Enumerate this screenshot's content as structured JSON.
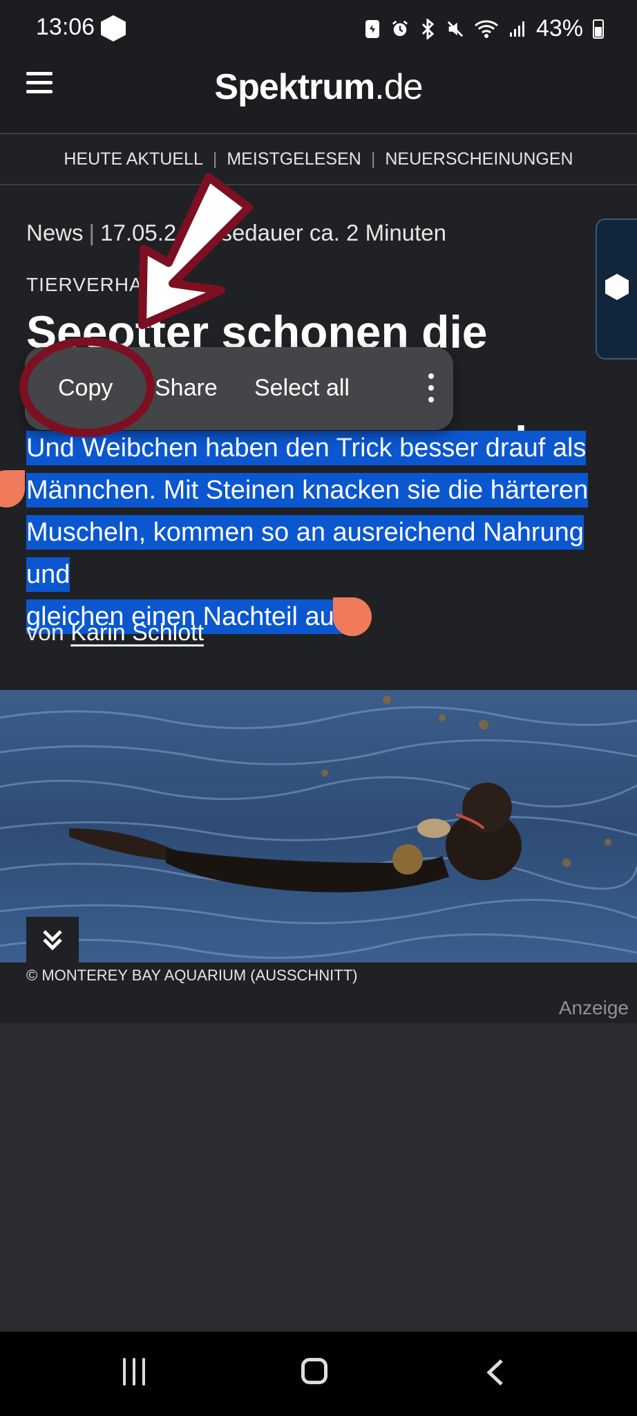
{
  "status_bar": {
    "time": "13:06",
    "battery_percent": "43%",
    "icons": [
      "app-shield-icon",
      "sim-icon",
      "alarm-icon",
      "bluetooth-icon",
      "mute-icon",
      "wifi-icon",
      "signal-icon",
      "battery-icon"
    ]
  },
  "header": {
    "logo_main": "Spektrum",
    "logo_tld": ".de",
    "menu_icon": "hamburger-menu-icon"
  },
  "top_nav": {
    "items": [
      "HEUTE AKTUELL",
      "MEISTGELESEN",
      "NEUERSCHEINUNGEN"
    ],
    "separator": "|"
  },
  "article": {
    "type": "News",
    "date": "17.05.2",
    "read_time": "Lesedauer ca. 2 Minuten",
    "kicker": "TIERVERHALT",
    "headline_line1": "Seeotter schonen die Zähne",
    "headline_line2": "uch",
    "lede_line1": "Und Weibchen haben den Trick besser drauf als",
    "lede_line2": "Männchen. Mit Steinen knacken sie die härteren",
    "lede_line3": "Muscheln, kommen so an ausreichend Nahrung und",
    "lede_line4": "gleichen einen Nachteil aus.",
    "byline_prefix": "von",
    "author": "Karin Schlott",
    "image_caption": "© MONTEREY BAY AQUARIUM (AUSSCHNITT)",
    "ad_label": "Anzeige"
  },
  "context_menu": {
    "copy": "Copy",
    "share": "Share",
    "select_all": "Select all",
    "more_icon": "more-vertical-icon"
  },
  "colors": {
    "background": "#1f2124",
    "selection": "#0b57d0",
    "handle": "#f07b5a",
    "annotation": "#7d0f22"
  }
}
